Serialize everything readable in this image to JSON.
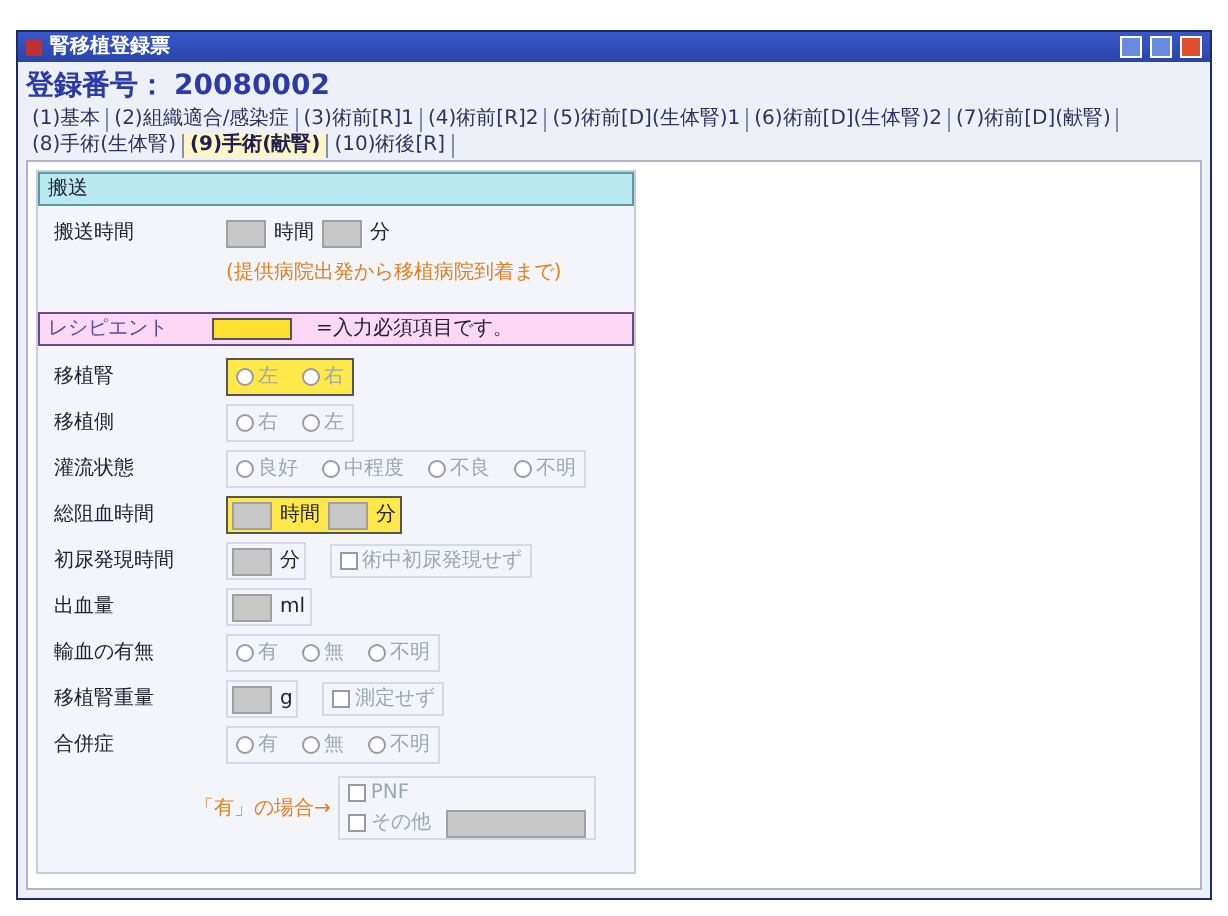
{
  "window": {
    "title": "腎移植登録票"
  },
  "header": {
    "label": "登録番号：",
    "value": "20080002"
  },
  "tabs": [
    {
      "label": "(1)基本",
      "selected": false
    },
    {
      "label": "(2)組織適合/感染症",
      "selected": false
    },
    {
      "label": "(3)術前[R]1",
      "selected": false
    },
    {
      "label": "(4)術前[R]2",
      "selected": false
    },
    {
      "label": "(5)術前[D](生体腎)1",
      "selected": false
    },
    {
      "label": "(6)術前[D](生体腎)2",
      "selected": false
    },
    {
      "label": "(7)術前[D](献腎)",
      "selected": false
    },
    {
      "label": "(8)手術(生体腎)",
      "selected": false
    },
    {
      "label": "(9)手術(献腎)",
      "selected": true
    },
    {
      "label": "(10)術後[R]",
      "selected": false
    }
  ],
  "transport": {
    "title": "搬送",
    "label": "搬送時間",
    "units": [
      "時間",
      "分"
    ],
    "note": "(提供病院出発から移植病院到着まで)"
  },
  "recipient": {
    "title": "レシピエント",
    "legend": "=入力必須項目です。"
  },
  "rows": [
    {
      "kind": "radio",
      "label": "移植腎",
      "required": true,
      "options": [
        {
          "label": "左",
          "selected": false
        },
        {
          "label": "右",
          "selected": false
        }
      ]
    },
    {
      "kind": "radio",
      "label": "移植側",
      "required": false,
      "options": [
        {
          "label": "右",
          "selected": false
        },
        {
          "label": "左",
          "selected": false
        }
      ]
    },
    {
      "kind": "radio",
      "label": "灌流状態",
      "required": false,
      "options": [
        {
          "label": "良好",
          "selected": false
        },
        {
          "label": "中程度",
          "selected": false
        },
        {
          "label": "不良",
          "selected": false
        },
        {
          "label": "不明",
          "selected": false
        }
      ]
    },
    {
      "kind": "amount",
      "label": "総阻血時間",
      "required": true,
      "units": [
        "時間",
        "分"
      ]
    },
    {
      "kind": "amount",
      "label": "初尿発現時間",
      "required": false,
      "units": [
        "分"
      ],
      "check": {
        "label": "術中初尿発現せず",
        "checked": false
      }
    },
    {
      "kind": "amount",
      "label": "出血量",
      "required": false,
      "units": [
        "ml"
      ]
    },
    {
      "kind": "radio",
      "label": "輸血の有無",
      "required": false,
      "options": [
        {
          "label": "有",
          "selected": false
        },
        {
          "label": "無",
          "selected": false
        },
        {
          "label": "不明",
          "selected": false
        }
      ]
    },
    {
      "kind": "amount",
      "label": "移植腎重量",
      "required": false,
      "units": [
        "g"
      ],
      "check": {
        "label": "測定せず",
        "checked": false
      }
    },
    {
      "kind": "radio",
      "label": "合併症",
      "required": false,
      "options": [
        {
          "label": "有",
          "selected": false
        },
        {
          "label": "無",
          "selected": false
        },
        {
          "label": "不明",
          "selected": false
        }
      ]
    },
    {
      "kind": "detail",
      "label": "「有」の場合→",
      "checks": [
        {
          "label": "PNF",
          "checked": false
        },
        {
          "label": "その他",
          "checked": false
        }
      ]
    }
  ]
}
